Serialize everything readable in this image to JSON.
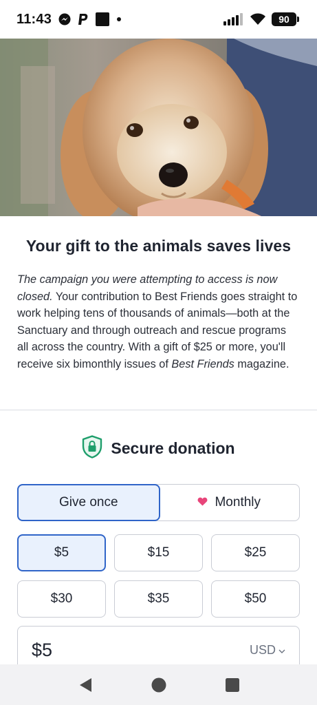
{
  "status_bar": {
    "time": "11:43",
    "battery": "90",
    "icons": [
      "messenger-icon",
      "paypal-icon",
      "square-app-icon",
      "dot-icon",
      "signal-icon",
      "wifi-icon",
      "battery-icon"
    ]
  },
  "hero": {
    "image": "dog-photo"
  },
  "intro": {
    "headline": "Your gift to the animals saves lives",
    "italic_lead": "The campaign you were attempting to access is now closed.",
    "body_1": " Your contribution to Best Friends goes straight to work helping tens of thousands of animals—both at the Sanctuary and through outreach and rescue programs all across the country. With a gift of $25 or more, you'll receive six bimonthly issues of ",
    "magazine": "Best Friends",
    "body_2": " magazine."
  },
  "donation": {
    "secure_title": "Secure donation",
    "frequency": {
      "once": "Give once",
      "monthly": "Monthly",
      "selected": "once"
    },
    "amounts": [
      "$5",
      "$15",
      "$25",
      "$30",
      "$35",
      "$50"
    ],
    "selected_amount": "$5",
    "amount_value": "$5",
    "currency": "USD"
  },
  "colors": {
    "accent": "#2f64c8",
    "selected_bg": "#e9f1fd",
    "heart": "#e8457a",
    "shield": "#1e9e6b"
  }
}
